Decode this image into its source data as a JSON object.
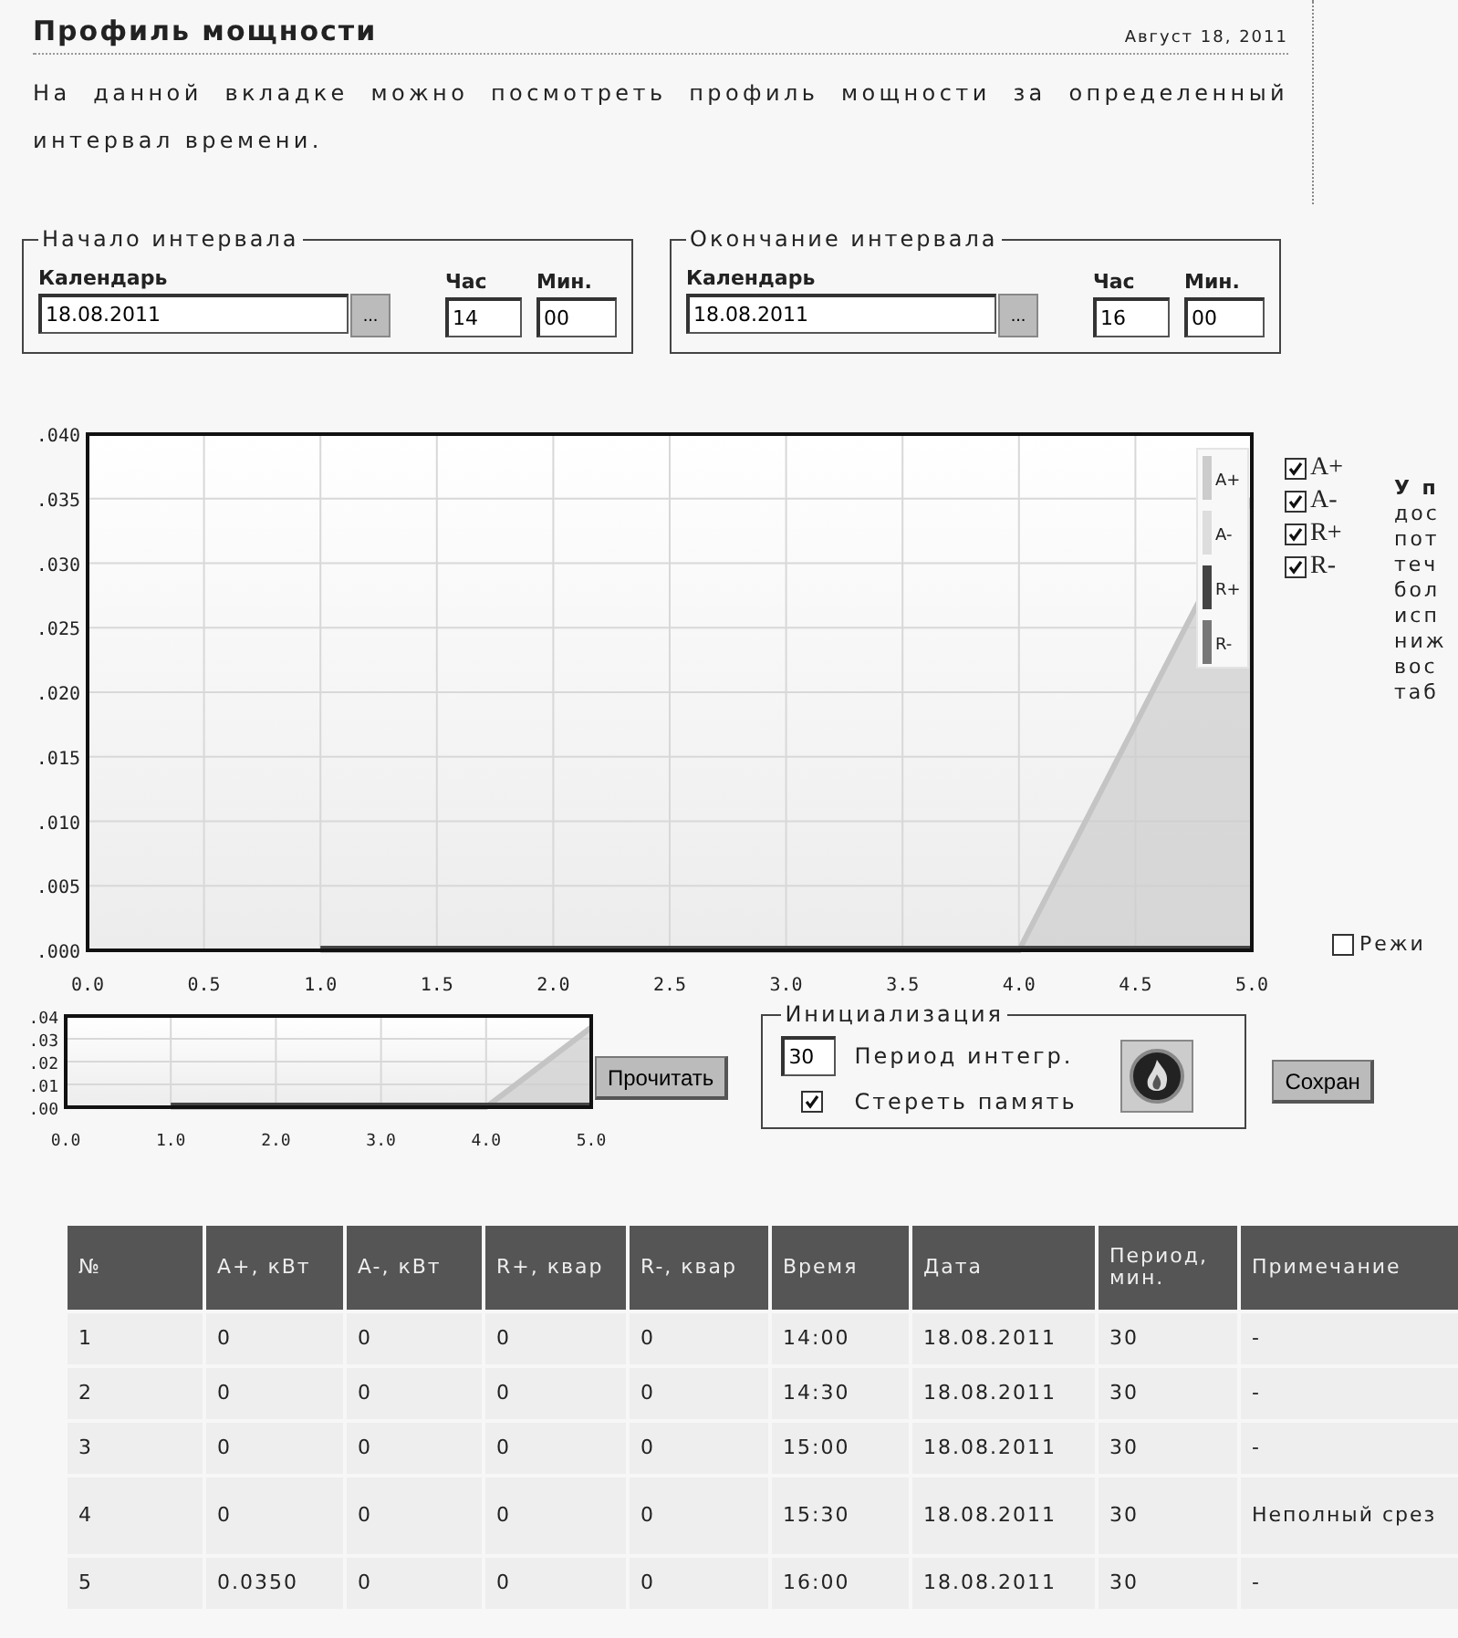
{
  "header": {
    "title": "Профиль мощности",
    "date": "Август 18, 2011",
    "description": "На данной вкладке можно посмотреть профиль мощности за определенный интервал времени."
  },
  "intervals": [
    {
      "legend": "Начало интервала",
      "calendar_label": "Календарь",
      "date": "18.08.2011",
      "picker": "...",
      "hour_label": "Час",
      "hour": "14",
      "min_label": "Мин.",
      "min": "00"
    },
    {
      "legend": "Окончание интервала",
      "calendar_label": "Календарь",
      "date": "18.08.2011",
      "picker": "...",
      "hour_label": "Час",
      "hour": "16",
      "min_label": "Мин.",
      "min": "00"
    }
  ],
  "chart": {
    "chart_data": {
      "type": "area",
      "x": [
        1,
        2,
        3,
        4,
        5
      ],
      "xlim": [
        0,
        5
      ],
      "ylim": [
        0,
        0.04
      ],
      "values": [
        0,
        0,
        0,
        0,
        0.035
      ],
      "grid": true,
      "xticks": [
        {
          "value": 0,
          "label": "0.0"
        },
        {
          "value": 0.5,
          "label": "0.5"
        },
        {
          "value": 1,
          "label": "1.0"
        },
        {
          "value": 1.5,
          "label": "1.5"
        },
        {
          "value": 2,
          "label": "2.0"
        },
        {
          "value": 2.5,
          "label": "2.5"
        },
        {
          "value": 3,
          "label": "3.0"
        },
        {
          "value": 3.5,
          "label": "3.5"
        },
        {
          "value": 4,
          "label": "4.0"
        },
        {
          "value": 4.5,
          "label": "4.5"
        },
        {
          "value": 5,
          "label": "5.0"
        }
      ],
      "yticks": [
        {
          "value": 0,
          "label": ".000"
        },
        {
          "value": 0.005,
          "label": ".005"
        },
        {
          "value": 0.01,
          "label": ".010"
        },
        {
          "value": 0.015,
          "label": ".015"
        },
        {
          "value": 0.02,
          "label": ".020"
        },
        {
          "value": 0.025,
          "label": ".025"
        },
        {
          "value": 0.03,
          "label": ".030"
        },
        {
          "value": 0.035,
          "label": ".035"
        },
        {
          "value": 0.04,
          "label": ".040"
        }
      ]
    },
    "legend": [
      {
        "name": "A+",
        "color": "#cccccc"
      },
      {
        "name": "A-",
        "color": "#dddddd"
      },
      {
        "name": "R+",
        "color": "#444444"
      },
      {
        "name": "R-",
        "color": "#777777"
      }
    ]
  },
  "series_toggles": [
    {
      "label": "A+",
      "checked": true
    },
    {
      "label": "A-",
      "checked": true
    },
    {
      "label": "R+",
      "checked": true
    },
    {
      "label": "R-",
      "checked": true
    }
  ],
  "side_text": {
    "heading": "У п",
    "lines": [
      "дос",
      "пот",
      "теч",
      "бол",
      "исп",
      "ниж",
      "вос",
      "таб"
    ]
  },
  "mode": {
    "label": "Режи",
    "checked": false
  },
  "mini_chart": {
    "chart_data": {
      "type": "area",
      "x": [
        1,
        2,
        3,
        4,
        5
      ],
      "xlim": [
        0,
        5
      ],
      "ylim": [
        0,
        0.04
      ],
      "values": [
        0,
        0,
        0,
        0,
        0.035
      ],
      "grid": true,
      "xticks": [
        {
          "value": 0,
          "label": "0.0"
        },
        {
          "value": 1,
          "label": "1.0"
        },
        {
          "value": 2,
          "label": "2.0"
        },
        {
          "value": 3,
          "label": "3.0"
        },
        {
          "value": 4,
          "label": "4.0"
        },
        {
          "value": 5,
          "label": "5.0"
        }
      ],
      "yticks": [
        {
          "value": 0,
          "label": ".00"
        },
        {
          "value": 0.01,
          "label": ".01"
        },
        {
          "value": 0.02,
          "label": ".02"
        },
        {
          "value": 0.03,
          "label": ".03"
        },
        {
          "value": 0.04,
          "label": ".04"
        }
      ]
    }
  },
  "read_button": "Прочитать",
  "init": {
    "legend": "Инициализация",
    "period": "30",
    "period_label": "Период интегр.",
    "erase_label": "Стереть память",
    "erase_checked": true
  },
  "save_button": "Сохран",
  "table": {
    "columns": [
      "№",
      "A+, кВт",
      "A-, кВт",
      "R+, квар",
      "R-, квар",
      "Время",
      "Дата",
      "Период, мин.",
      "Примечание"
    ],
    "rows": [
      [
        "1",
        "0",
        "0",
        "0",
        "0",
        "14:00",
        "18.08.2011",
        "30",
        "-"
      ],
      [
        "2",
        "0",
        "0",
        "0",
        "0",
        "14:30",
        "18.08.2011",
        "30",
        "-"
      ],
      [
        "3",
        "0",
        "0",
        "0",
        "0",
        "15:00",
        "18.08.2011",
        "30",
        "-"
      ],
      [
        "4",
        "0",
        "0",
        "0",
        "0",
        "15:30",
        "18.08.2011",
        "30",
        "Неполный срез"
      ],
      [
        "5",
        "0.0350",
        "0",
        "0",
        "0",
        "16:00",
        "18.08.2011",
        "30",
        "-"
      ]
    ]
  }
}
